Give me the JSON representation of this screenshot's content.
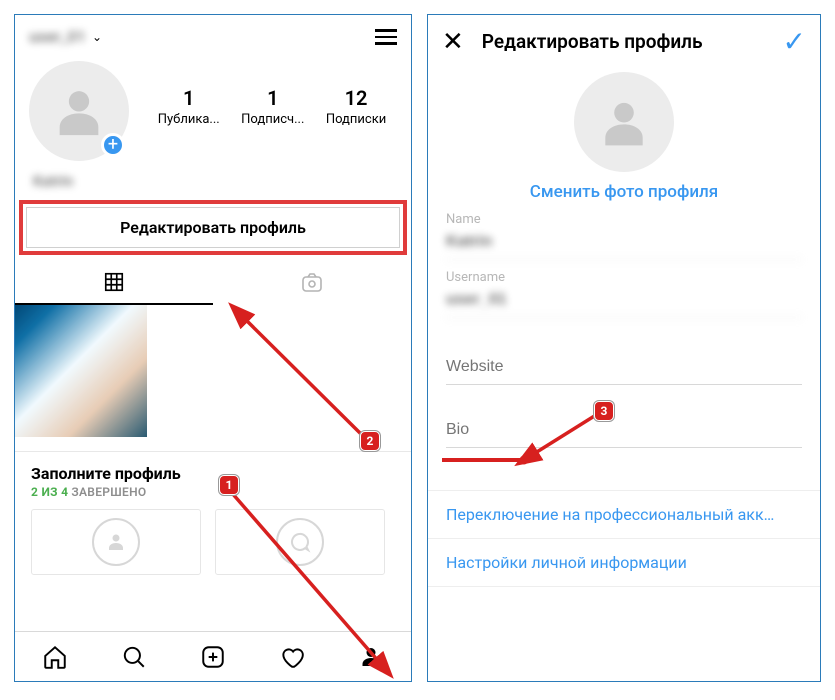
{
  "left": {
    "username": "user_01",
    "stats": {
      "posts": {
        "value": "1",
        "label": "Публика..."
      },
      "followers": {
        "value": "1",
        "label": "Подписч..."
      },
      "following": {
        "value": "12",
        "label": "Подписки"
      }
    },
    "display_name": "Katrin",
    "edit_profile": "Редактировать профиль",
    "suggestion": {
      "title": "Заполните профиль",
      "progress_done": "2 ИЗ 4",
      "progress_rest": "ЗАВЕРШЕНО"
    }
  },
  "right": {
    "header_title": "Редактировать профиль",
    "change_photo": "Сменить фото профиля",
    "fields": {
      "name": {
        "label": "Name",
        "value": "Katrin"
      },
      "username": {
        "label": "Username",
        "value": "user_01"
      },
      "website": {
        "label": "Website",
        "value": ""
      },
      "bio": {
        "label": "Bio",
        "value": ""
      }
    },
    "links": {
      "pro": "Переключение на профессиональный акк…",
      "privacy": "Настройки личной информации"
    }
  },
  "annotations": {
    "b1": "1",
    "b2": "2",
    "b3": "3"
  }
}
